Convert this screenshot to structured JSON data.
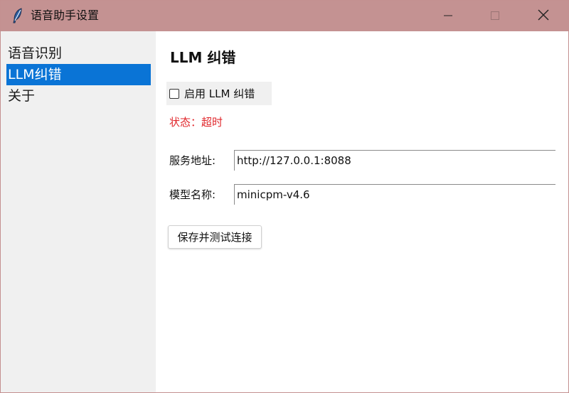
{
  "window": {
    "title": "语音助手设置",
    "icon": "feather-icon",
    "controls": {
      "minimize": "minimize-icon",
      "maximize": "maximize-icon",
      "close": "close-icon"
    }
  },
  "sidebar": {
    "items": [
      {
        "label": "语音识别",
        "selected": false
      },
      {
        "label": "LLM纠错",
        "selected": true
      },
      {
        "label": "关于",
        "selected": false
      }
    ]
  },
  "main": {
    "title": "LLM 纠错",
    "enable_checkbox": {
      "label": "启用 LLM 纠错",
      "checked": false
    },
    "status": "状态：超时",
    "service_address": {
      "label": "服务地址:",
      "value": "http://127.0.0.1:8088"
    },
    "model_name": {
      "label": "模型名称:",
      "value": "minicpm-v4.6"
    },
    "save_button_label": "保存并测试连接"
  },
  "colors": {
    "titlebar": "#c49292",
    "sidebar_bg": "#f0f0f0",
    "selected_bg": "#0a74d6",
    "status_error": "#e0262b"
  }
}
